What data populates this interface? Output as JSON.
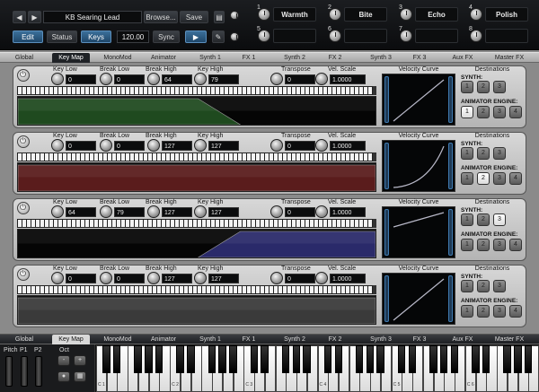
{
  "header": {
    "preset_name": "KB Searing Lead",
    "browse_label": "Browse...",
    "save_label": "Save",
    "edit_label": "Edit",
    "status_label": "Status",
    "keys_label": "Keys",
    "tempo": "120.00",
    "sync_label": "Sync",
    "play_icon": "play-icon",
    "wrench_icon": "wrench-icon",
    "macros": [
      {
        "num": "1",
        "name": "Warmth"
      },
      {
        "num": "2",
        "name": "Bite"
      },
      {
        "num": "3",
        "name": "Echo"
      },
      {
        "num": "4",
        "name": "Polish"
      },
      {
        "num": "5",
        "name": ""
      },
      {
        "num": "6",
        "name": ""
      },
      {
        "num": "7",
        "name": ""
      },
      {
        "num": "8",
        "name": ""
      }
    ]
  },
  "tabs": [
    "Global",
    "Key Map",
    "MonoMod",
    "Animator",
    "Synth 1",
    "FX 1",
    "Synth 2",
    "FX 2",
    "Synth 3",
    "FX 3",
    "Aux FX",
    "Master FX"
  ],
  "active_tab": "Key Map",
  "param_labels": {
    "key_low": "Key Low",
    "break_low": "Break Low",
    "break_high": "Break High",
    "key_high": "Key High",
    "transpose": "Transpose",
    "vel_scale": "Vel. Scale",
    "velocity_curve": "Velocity Curve",
    "destinations": "Destinations",
    "synth": "SYNTH:",
    "animator_engine": "ANIMATOR ENGINE:"
  },
  "layers": [
    {
      "key_low": "0",
      "break_low": "0",
      "break_high": "64",
      "key_high": "79",
      "transpose": "0",
      "vel_scale": "1.0000",
      "zone_color": "#1f4a1f",
      "zone": {
        "a": 0,
        "b": 0,
        "c": 64,
        "d": 79
      },
      "synth_on": [],
      "anim_on": [
        1
      ]
    },
    {
      "key_low": "0",
      "break_low": "0",
      "break_high": "127",
      "key_high": "127",
      "transpose": "0",
      "vel_scale": "1.0000",
      "zone_color": "#5a1c1c",
      "zone": {
        "a": 0,
        "b": 0,
        "c": 127,
        "d": 127
      },
      "synth_on": [],
      "anim_on": [
        2
      ]
    },
    {
      "key_low": "64",
      "break_low": "79",
      "break_high": "127",
      "key_high": "127",
      "transpose": "0",
      "vel_scale": "1.0000",
      "zone_color": "#2a2a6a",
      "zone": {
        "a": 64,
        "b": 79,
        "c": 127,
        "d": 127
      },
      "synth_on": [
        3
      ],
      "anim_on": []
    },
    {
      "key_low": "0",
      "break_low": "0",
      "break_high": "127",
      "key_high": "127",
      "transpose": "0",
      "vel_scale": "1.0000",
      "zone_color": "#3a3a3a",
      "zone": {
        "a": 0,
        "b": 0,
        "c": 127,
        "d": 127
      },
      "synth_on": [],
      "anim_on": []
    }
  ],
  "synth_buttons": [
    "1",
    "2",
    "3"
  ],
  "anim_buttons": [
    "1",
    "2",
    "3",
    "4"
  ],
  "bottom": {
    "pitch_label": "Pitch",
    "p1_label": "P1",
    "p2_label": "P2",
    "oct_label": "Oct",
    "oct_down": "-",
    "oct_up": "+",
    "octave_labels": [
      "C 1",
      "C 2",
      "C 3",
      "C 4",
      "C 5",
      "C 6"
    ]
  }
}
